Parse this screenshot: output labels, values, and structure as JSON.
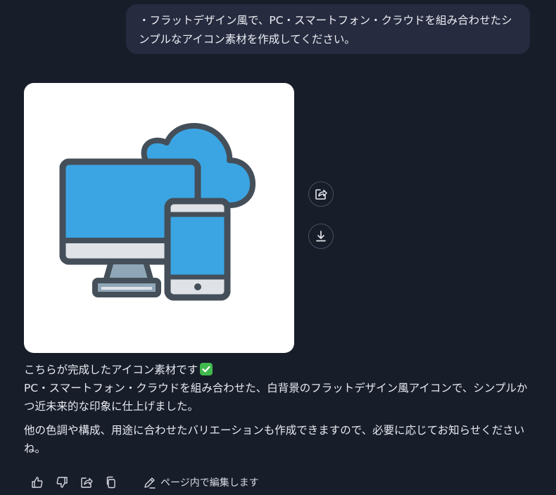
{
  "user_message": {
    "text": "・フラットデザイン風で、PC・スマートフォン・クラウドを組み合わせたシンプルなアイコン素材を作成してください。"
  },
  "image": {
    "icon": "pc-smartphone-cloud-flat-icon",
    "colors": {
      "background": "#ffffff",
      "screen": "#3ba5e4",
      "outline": "#444f59",
      "bezel": "#dfe3e8",
      "stand": "#8fa6b6",
      "cloud": "#3ba5e4"
    }
  },
  "side_actions": {
    "share_icon": "share-icon",
    "download_icon": "download-icon"
  },
  "assistant_message": {
    "line1": "こちらが完成したアイコン素材です",
    "line2": "PC・スマートフォン・クラウドを組み合わせた、白背景のフラットデザイン風アイコンで、シンプルかつ近未来的な印象に仕上げました。",
    "para2": "他の色調や構成、用途に合わせたバリエーションも作成できますので、必要に応じてお知らせくださいね。",
    "check_icon": "check-mark-emoji"
  },
  "action_bar": {
    "icons": [
      "thumbs-up-icon",
      "thumbs-down-icon",
      "share-icon",
      "copy-icon",
      "edit-icon"
    ],
    "edit_label": "ページ内で編集します"
  },
  "theme": {
    "background": "#181d2a",
    "bubble": "#262b3f",
    "text": "#e8eaf0",
    "check": "#40b94d"
  }
}
